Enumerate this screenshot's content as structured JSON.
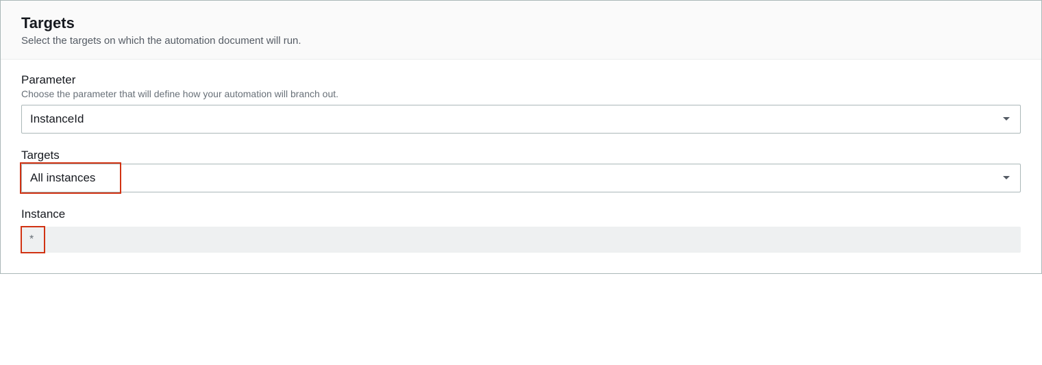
{
  "header": {
    "title": "Targets",
    "description": "Select the targets on which the automation document will run."
  },
  "parameter": {
    "label": "Parameter",
    "help": "Choose the parameter that will define how your automation will branch out.",
    "value": "InstanceId"
  },
  "targets": {
    "label": "Targets",
    "value": "All instances"
  },
  "instance": {
    "label": "Instance",
    "value": "*"
  }
}
